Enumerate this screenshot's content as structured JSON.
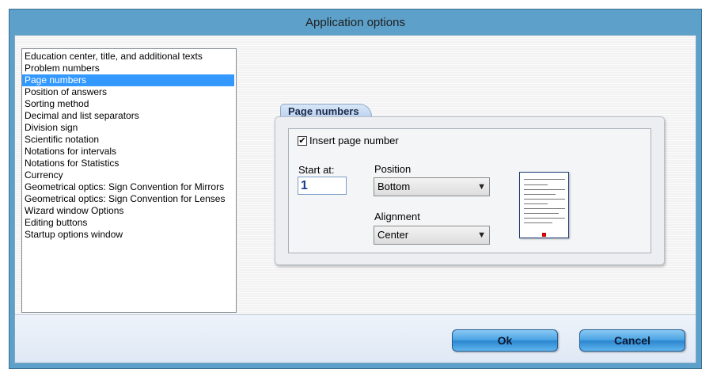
{
  "window": {
    "title": "Application options"
  },
  "options_list": {
    "items": [
      "Education center, title, and additional texts",
      "Problem numbers",
      "Page numbers",
      "Position of answers",
      "Sorting method",
      "Decimal and list separators",
      "Division sign",
      "Scientific notation",
      "Notations for intervals",
      "Notations for Statistics",
      "Currency",
      "Geometrical optics: Sign Convention for Mirrors",
      "Geometrical optics: Sign Convention for Lenses",
      "Wizard window Options",
      "Editing buttons",
      "Startup options window"
    ],
    "selected_index": 2
  },
  "page_numbers": {
    "tab_label": "Page numbers",
    "insert_label": "Insert page number",
    "insert_checked": true,
    "start_label": "Start at:",
    "start_value": "1",
    "position_label": "Position",
    "position_value": "Bottom",
    "alignment_label": "Alignment",
    "alignment_value": "Center"
  },
  "buttons": {
    "ok": "Ok",
    "cancel": "Cancel"
  },
  "colors": {
    "title_bar": "#5da0c9",
    "selection": "#3399ff",
    "button": "#4aa3e3",
    "page_marker": "#d40000"
  },
  "icons": {
    "checkbox": "check-icon",
    "dropdown": "chevron-down-icon"
  }
}
